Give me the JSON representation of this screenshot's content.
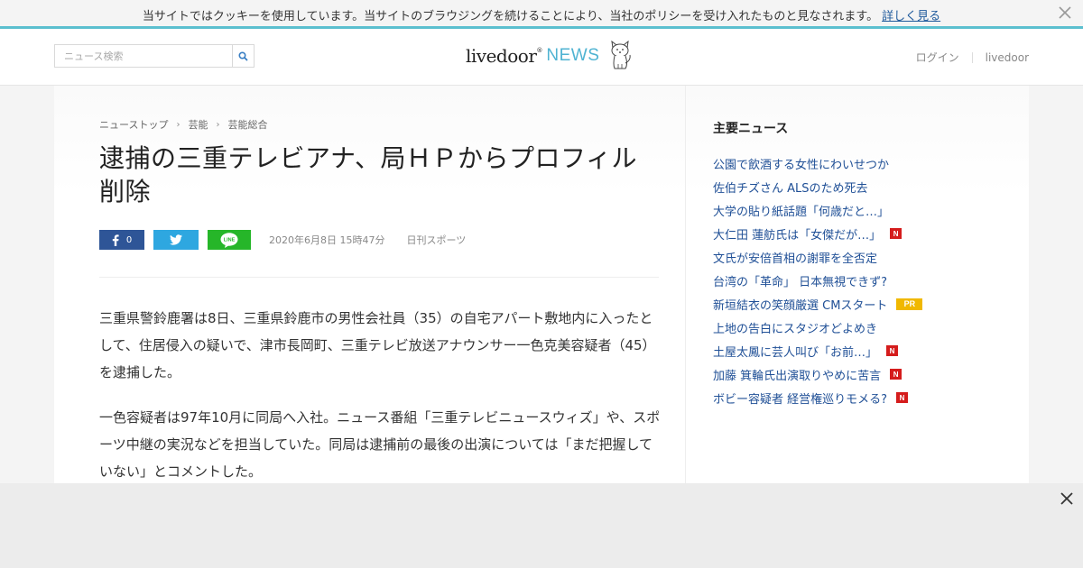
{
  "cookie": {
    "message": "当サイトではクッキーを使用しています。当サイトのブラウジングを続けることにより、当社のポリシーを受け入れたものと見なされます。",
    "link": "詳しく見る"
  },
  "header": {
    "search_placeholder": "ニュース検索",
    "logo_main": "livedoor",
    "logo_sup": "®",
    "logo_news": "NEWS",
    "login": "ログイン",
    "livedoor_link": "livedoor"
  },
  "article": {
    "breadcrumb": [
      "ニューストップ",
      "芸能",
      "芸能総合"
    ],
    "title": "逮捕の三重テレビアナ、局ＨＰからプロフィル削除",
    "fb_count": "0",
    "line_label": "LINE",
    "date": "2020年6月8日 15時47分",
    "source": "日刊スポーツ",
    "paragraphs": [
      "三重県警鈴鹿署は8日、三重県鈴鹿市の男性会社員（35）の自宅アパート敷地内に入ったとして、住居侵入の疑いで、津市長岡町、三重テレビ放送アナウンサー一色克美容疑者（45）を逮捕した。",
      "一色容疑者は97年10月に同局へ入社。ニュース番組「三重テレビニュースウィズ」や、スポーツ中継の実況などを担当していた。同局は逮捕前の最後の出演については「まだ把握していない」とコメントした。"
    ]
  },
  "sidebar": {
    "title": "主要ニュース",
    "items": [
      {
        "text": "公園で飲酒する女性にわいせつか",
        "badge": ""
      },
      {
        "text": "佐伯チズさん ALSのため死去",
        "badge": ""
      },
      {
        "text": "大学の貼り紙話題「何歳だと…」",
        "badge": ""
      },
      {
        "text": "大仁田 蓮舫氏は「女傑だが…」",
        "badge": "N"
      },
      {
        "text": "文氏が安倍首相の謝罪を全否定",
        "badge": ""
      },
      {
        "text": "台湾の「革命」 日本無視できず?",
        "badge": ""
      },
      {
        "text": "新垣結衣の笑顔厳選 CMスタート",
        "badge": "PR"
      },
      {
        "text": "上地の告白にスタジオどよめき",
        "badge": ""
      },
      {
        "text": "土屋太鳳に芸人叫び「お前…」",
        "badge": "N"
      },
      {
        "text": "加藤 箕輪氏出演取りやめに苦言",
        "badge": "N"
      },
      {
        "text": "ボビー容疑者 経営権巡りモメる?",
        "badge": "N"
      }
    ]
  },
  "icons": {
    "close": "close-icon",
    "search": "search-icon",
    "facebook": "facebook-icon",
    "twitter": "twitter-icon",
    "line": "line-icon",
    "dog": "dog-mascot-icon"
  },
  "colors": {
    "accent": "#5bbfcf",
    "link": "#1f4f96",
    "facebook": "#2e5597",
    "twitter": "#2ea7e0",
    "line": "#26b629",
    "badge_n": "#d51c1c",
    "badge_pr": "#f0b800"
  }
}
